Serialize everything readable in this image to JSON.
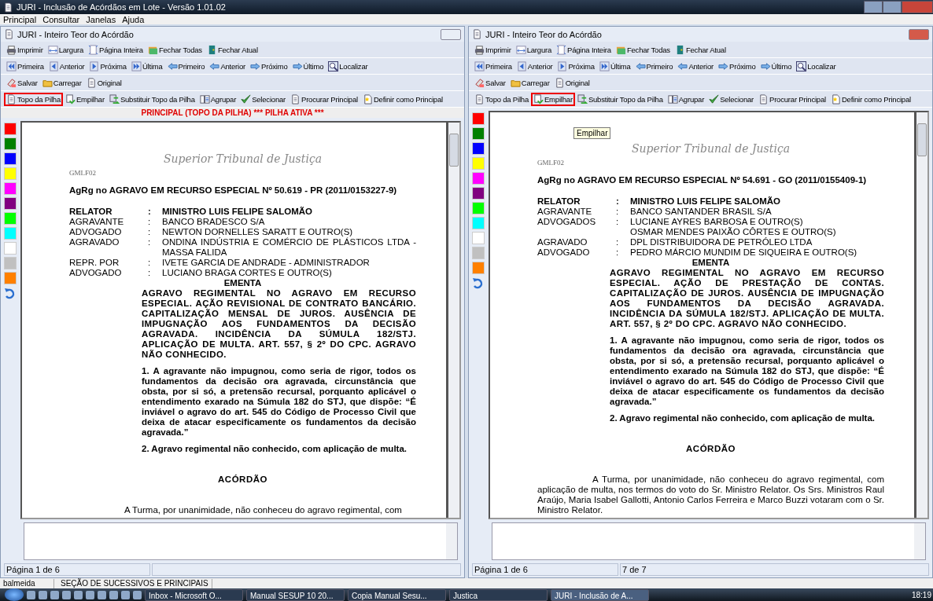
{
  "window": {
    "title": "JURI - Inclusão de Acórdãos em Lote - Versão 1.01.02"
  },
  "menu": [
    "Principal",
    "Consultar",
    "Janelas",
    "Ajuda"
  ],
  "panes": [
    {
      "title": "JURI - Inteiro Teor do Acórdão",
      "active": false,
      "toolbars": [
        [
          {
            "label": "Imprimir",
            "highlighted": false
          },
          {
            "label": "Largura",
            "highlighted": false
          },
          {
            "label": "Página Inteira",
            "highlighted": false
          },
          {
            "label": "Fechar Todas",
            "highlighted": false
          },
          {
            "label": "Fechar Atual",
            "highlighted": false
          }
        ],
        [
          {
            "label": "Primeira",
            "highlighted": false
          },
          {
            "label": "Anterior",
            "highlighted": false
          },
          {
            "label": "Próxima",
            "highlighted": false
          },
          {
            "label": "Última",
            "highlighted": false
          },
          {
            "label": "Primeiro",
            "highlighted": false
          },
          {
            "label": "Anterior",
            "highlighted": false
          },
          {
            "label": "Próximo",
            "highlighted": false
          },
          {
            "label": "Último",
            "highlighted": false
          },
          {
            "label": "Localizar",
            "highlighted": false
          }
        ],
        [
          {
            "label": "Salvar",
            "highlighted": false
          },
          {
            "label": "Carregar",
            "highlighted": false
          },
          {
            "label": "Original",
            "highlighted": false
          }
        ],
        [
          {
            "label": "Topo da Pilha",
            "highlighted": true
          },
          {
            "label": "Empilhar",
            "highlighted": false
          },
          {
            "label": "Substituir Topo da Pilha",
            "highlighted": false
          },
          {
            "label": "Agrupar",
            "highlighted": false
          },
          {
            "label": "Selecionar",
            "highlighted": false
          },
          {
            "label": "Procurar Principal",
            "highlighted": false
          },
          {
            "label": "Definir como Principal",
            "highlighted": false
          }
        ]
      ],
      "banner": "PRINCIPAL (TOPO DA PILHA) *** PILHA ATIVA ***",
      "palette": [
        {
          "color": "#ff0000"
        },
        {
          "color": "#008000"
        },
        {
          "color": "#0000ff"
        },
        {
          "color": "#ffff00"
        },
        {
          "color": "#ff00ff"
        },
        {
          "color": "#800080"
        },
        {
          "color": "#00ff00"
        },
        {
          "color": "#00ffff"
        },
        {
          "color": "#ffffff"
        },
        {
          "color": "#c0c0c0"
        },
        {
          "color": "#ff8000"
        }
      ],
      "document": {
        "logo": "Superior Tribunal de Justiça",
        "code": "GMLF02",
        "heading": "AgRg no AGRAVO EM RECURSO ESPECIAL Nº 50.619 - PR (2011/0153227-9)",
        "parties": [
          {
            "label": "RELATOR",
            "separator": ":",
            "values": [
              "MINISTRO LUIS FELIPE SALOMÃO"
            ],
            "bold": true
          },
          {
            "label": "AGRAVANTE",
            "separator": ":",
            "values": [
              "BANCO BRADESCO S/A"
            ],
            "bold": false
          },
          {
            "label": "ADVOGADO",
            "separator": ":",
            "values": [
              "NEWTON DORNELLES SARATT E OUTRO(S)"
            ],
            "bold": false
          },
          {
            "label": "AGRAVADO",
            "separator": ":",
            "values": [
              "ONDINA INDÚSTRIA E COMÉRCIO DE PLÁSTICOS LTDA - MASSA FALIDA"
            ],
            "bold": false
          },
          {
            "label": "REPR. POR",
            "separator": ":",
            "values": [
              "IVETE GARCIA DE ANDRADE - ADMINISTRADOR"
            ],
            "bold": false
          },
          {
            "label": "ADVOGADO",
            "separator": ":",
            "values": [
              "LUCIANO BRAGA CORTES E OUTRO(S)"
            ],
            "bold": false
          }
        ],
        "section": "EMENTA",
        "summary": "AGRAVO REGIMENTAL NO AGRAVO EM RECURSO ESPECIAL. AÇÃO REVISIONAL DE CONTRATO BANCÁRIO. CAPITALIZAÇÃO MENSAL DE JUROS.  AUSÊNCIA DE IMPUGNAÇÃO AOS FUNDAMENTOS DA DECISÃO AGRAVADA. INCIDÊNCIA DA SÚMULA 182/STJ. APLICAÇÃO DE MULTA. ART. 557, § 2º DO CPC. AGRAVO NÃO CONHECIDO.",
        "paragraphs": [
          "1. A agravante não impugnou, como seria de rigor, todos os fundamentos da decisão ora agravada, circunstância que obsta, por si só, a pretensão recursal, porquanto aplicável o entendimento exarado na Súmula 182 do STJ, que dispõe: “É inviável o agravo do art. 545 do Código de Processo Civil que deixa de atacar especificamente os fundamentos da decisão agravada.”",
          "2. Agravo regimental não conhecido, com aplicação de multa."
        ],
        "decision_title": "ACÓRDÃO",
        "decision_text": "A Turma, por unanimidade, não conheceu do agravo regimental, com"
      },
      "status": [
        "Página 1 de 6"
      ]
    },
    {
      "title": "JURI - Inteiro Teor do Acórdão",
      "active": true,
      "toolbars": [
        [
          {
            "label": "Imprimir",
            "highlighted": false
          },
          {
            "label": "Largura",
            "highlighted": false
          },
          {
            "label": "Página Inteira",
            "highlighted": false
          },
          {
            "label": "Fechar Todas",
            "highlighted": false
          },
          {
            "label": "Fechar Atual",
            "highlighted": false
          }
        ],
        [
          {
            "label": "Primeira",
            "highlighted": false
          },
          {
            "label": "Anterior",
            "highlighted": false
          },
          {
            "label": "Próxima",
            "highlighted": false
          },
          {
            "label": "Última",
            "highlighted": false
          },
          {
            "label": "Primeiro",
            "highlighted": false
          },
          {
            "label": "Anterior",
            "highlighted": false
          },
          {
            "label": "Próximo",
            "highlighted": false
          },
          {
            "label": "Último",
            "highlighted": false
          },
          {
            "label": "Localizar",
            "highlighted": false
          }
        ],
        [
          {
            "label": "Salvar",
            "highlighted": false
          },
          {
            "label": "Carregar",
            "highlighted": false
          },
          {
            "label": "Original",
            "highlighted": false
          }
        ],
        [
          {
            "label": "Topo da Pilha",
            "highlighted": false
          },
          {
            "label": "Empilhar",
            "highlighted": true
          },
          {
            "label": "Substituir Topo da Pilha",
            "highlighted": false
          },
          {
            "label": "Agrupar",
            "highlighted": false
          },
          {
            "label": "Selecionar",
            "highlighted": false
          },
          {
            "label": "Procurar Principal",
            "highlighted": false
          },
          {
            "label": "Definir como Principal",
            "highlighted": false
          }
        ]
      ],
      "tooltip": "Empilhar",
      "palette": [
        {
          "color": "#ff0000"
        },
        {
          "color": "#008000"
        },
        {
          "color": "#0000ff"
        },
        {
          "color": "#ffff00"
        },
        {
          "color": "#ff00ff"
        },
        {
          "color": "#800080"
        },
        {
          "color": "#00ff00"
        },
        {
          "color": "#00ffff"
        },
        {
          "color": "#ffffff"
        },
        {
          "color": "#c0c0c0"
        },
        {
          "color": "#ff8000"
        }
      ],
      "document": {
        "logo": "Superior Tribunal de Justiça",
        "code": "GMLF02",
        "heading": "AgRg no AGRAVO EM RECURSO ESPECIAL Nº 54.691 - GO (2011/0155409-1)",
        "parties": [
          {
            "label": "RELATOR",
            "separator": ":",
            "values": [
              "MINISTRO LUIS FELIPE SALOMÃO"
            ],
            "bold": true
          },
          {
            "label": "AGRAVANTE",
            "separator": ":",
            "values": [
              "BANCO SANTANDER BRASIL S/A"
            ],
            "bold": false
          },
          {
            "label": "ADVOGADOS",
            "separator": ":",
            "values": [
              "LUCIANE AYRES BARBOSA E OUTRO(S)",
              "OSMAR MENDES PAIXÃO CÔRTES E OUTRO(S)"
            ],
            "bold": false
          },
          {
            "label": "AGRAVADO",
            "separator": ":",
            "values": [
              "DPL DISTRIBUIDORA DE PETRÓLEO LTDA"
            ],
            "bold": false
          },
          {
            "label": "ADVOGADO",
            "separator": ":",
            "values": [
              "PEDRO MÁRCIO MUNDIM DE SIQUEIRA E OUTRO(S)"
            ],
            "bold": false
          }
        ],
        "section": "EMENTA",
        "summary": "AGRAVO REGIMENTAL NO AGRAVO EM RECURSO ESPECIAL. AÇÃO DE PRESTAÇÃO DE CONTAS. CAPITALIZAÇÃO DE JUROS. AUSÊNCIA DE IMPUGNAÇÃO AOS FUNDAMENTOS DA DECISÃO AGRAVADA. INCIDÊNCIA DA SÚMULA 182/STJ. APLICAÇÃO DE MULTA. ART. 557, § 2º DO CPC. AGRAVO NÃO CONHECIDO.",
        "paragraphs": [
          "1. A agravante não impugnou, como seria de rigor, todos os fundamentos da decisão ora agravada, circunstância que obsta, por si só, a pretensão recursal, porquanto aplicável o entendimento exarado na Súmula 182 do STJ, que dispõe: “É inviável o agravo do art. 545 do Código de Processo Civil que deixa de atacar especificamente os fundamentos da decisão agravada.”",
          "2. Agravo regimental não conhecido, com aplicação de multa."
        ],
        "decision_title": "ACÓRDÃO",
        "decision_text": "A Turma, por unanimidade, não conheceu do agravo regimental, com aplicação de multa, nos termos do voto do Sr. Ministro Relator. Os Srs. Ministros Raul Araújo, Maria Isabel Gallotti, Antonio Carlos Ferreira e Marco Buzzi votaram com o Sr. Ministro Relator."
      },
      "status": [
        "Página 1 de 6",
        "7 de 7"
      ]
    }
  ],
  "footer": [
    "balmeida",
    "SEÇÃO DE SUCESSIVOS E PRINCIPAIS"
  ],
  "taskbar": {
    "items": [
      {
        "label": "Inbox - Microsoft O...",
        "selected": false
      },
      {
        "label": "Manual SESUP 10 20...",
        "selected": false
      },
      {
        "label": "Copia Manual Sesu...",
        "selected": false
      },
      {
        "label": "Justica",
        "selected": false
      },
      {
        "label": "JURI - Inclusão de A...",
        "selected": true
      }
    ],
    "clock": "18:19"
  }
}
